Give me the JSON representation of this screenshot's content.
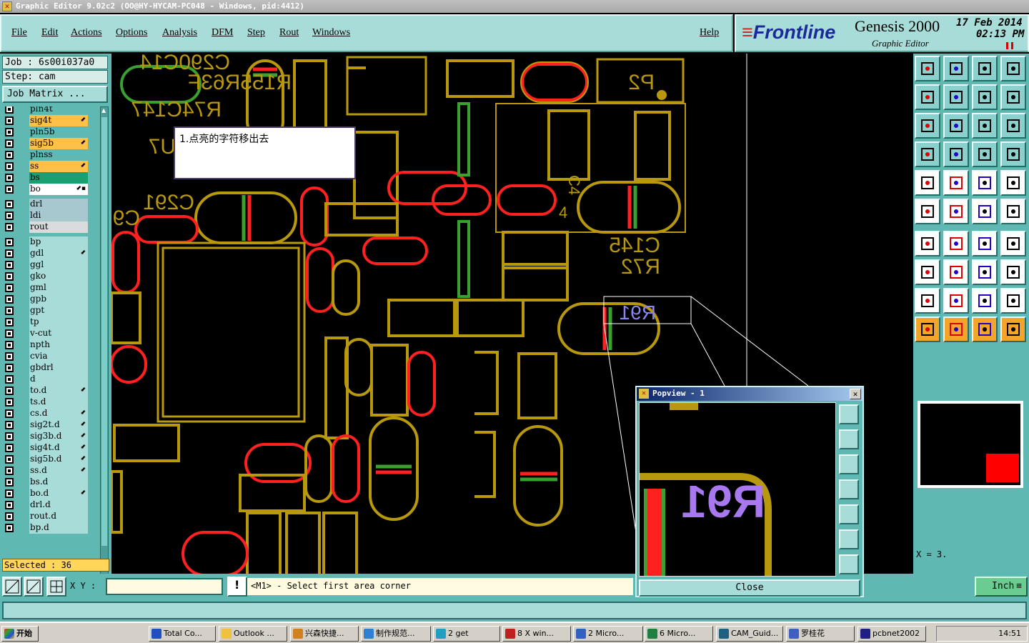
{
  "window": {
    "title": "Graphic Editor 9.02c2 (OO@HY-HYCAM-PC048 - Windows, pid:4412)"
  },
  "menu": {
    "items": [
      "File",
      "Edit",
      "Actions",
      "Options",
      "Analysis",
      "DFM",
      "Step",
      "Rout",
      "Windows"
    ],
    "help": "Help"
  },
  "brand": {
    "logo": "Frontline",
    "product": "Genesis 2000",
    "subtitle": "Graphic Editor",
    "date": "17 Feb 2014",
    "time": "02:13 PM"
  },
  "job": {
    "job_label": "Job : 6s00i037a0",
    "step_label": "Step: cam",
    "matrix_button": "Job Matrix ..."
  },
  "layers": [
    {
      "name": "pln4t",
      "color": "#5fb8b2"
    },
    {
      "name": "sig4t",
      "color": "#ffc04a",
      "flag": "⬋"
    },
    {
      "name": "pln5b",
      "color": "#5fb8b2"
    },
    {
      "name": "sig5b",
      "color": "#ffc04a",
      "flag": "⬋"
    },
    {
      "name": "plnss",
      "color": "#5fb8b2"
    },
    {
      "name": "ss",
      "color": "#ffc04a",
      "flag": "⬋"
    },
    {
      "name": "bs",
      "color": "#1aa070"
    },
    {
      "name": "bo",
      "color": "#ffffff",
      "flag": "⬋▪"
    },
    {
      "name": "drl",
      "color": "#a8c8d0"
    },
    {
      "name": "ldi",
      "color": "#a8c8d0"
    },
    {
      "name": "rout",
      "color": "#d8dcdc"
    },
    {
      "name": "bp",
      "color": "#a8dcd8"
    },
    {
      "name": "gdl",
      "color": "#a8dcd8",
      "flag": "⬋"
    },
    {
      "name": "ggl",
      "color": "#a8dcd8"
    },
    {
      "name": "gko",
      "color": "#a8dcd8"
    },
    {
      "name": "gml",
      "color": "#a8dcd8"
    },
    {
      "name": "gpb",
      "color": "#a8dcd8"
    },
    {
      "name": "gpt",
      "color": "#a8dcd8"
    },
    {
      "name": "tp",
      "color": "#a8dcd8"
    },
    {
      "name": "v-cut",
      "color": "#a8dcd8"
    },
    {
      "name": "npth",
      "color": "#a8dcd8"
    },
    {
      "name": "cvia",
      "color": "#a8dcd8"
    },
    {
      "name": "gbdrl",
      "color": "#a8dcd8"
    },
    {
      "name": "d",
      "color": "#a8dcd8"
    },
    {
      "name": "to.d",
      "color": "#a8dcd8",
      "flag": "⬋"
    },
    {
      "name": "ts.d",
      "color": "#a8dcd8"
    },
    {
      "name": "cs.d",
      "color": "#a8dcd8",
      "flag": "⬋"
    },
    {
      "name": "sig2t.d",
      "color": "#a8dcd8",
      "flag": "⬋"
    },
    {
      "name": "sig3b.d",
      "color": "#a8dcd8",
      "flag": "⬋"
    },
    {
      "name": "sig4t.d",
      "color": "#a8dcd8",
      "flag": "⬋"
    },
    {
      "name": "sig5b.d",
      "color": "#a8dcd8",
      "flag": "⬋"
    },
    {
      "name": "ss.d",
      "color": "#a8dcd8",
      "flag": "⬋"
    },
    {
      "name": "bs.d",
      "color": "#a8dcd8"
    },
    {
      "name": "bo.d",
      "color": "#a8dcd8",
      "flag": "⬋"
    },
    {
      "name": "drl.d",
      "color": "#a8dcd8"
    },
    {
      "name": "rout.d",
      "color": "#a8dcd8"
    },
    {
      "name": "bp.d",
      "color": "#a8dcd8"
    }
  ],
  "selected": "Selected : 36",
  "status": {
    "xy_label": "X Y :",
    "xy_value": "",
    "prompt": "<M1> - Select first area corner",
    "unit": "Inch",
    "x_readout": "X = 3."
  },
  "popview": {
    "title": "Popview - 1",
    "close": "Close",
    "label": "R91"
  },
  "note": "1.点亮的字符移出去",
  "canvas": {
    "labels": [
      "C290C14",
      "R155R63F",
      "R74C147",
      "P2",
      "C145",
      "R72",
      "R91",
      "C291",
      "C9",
      "U7",
      "C4",
      "4"
    ]
  },
  "taskbar": {
    "start": "开始",
    "tasks": [
      "Total Co...",
      "Outlook ...",
      "兴森快捷...",
      "制作规范...",
      "2 get",
      "8 X win...",
      "2 Micro...",
      "6 Micro...",
      "CAM_Guid...",
      "罗桂花",
      "pcbnet2002"
    ],
    "clock": "14:51"
  },
  "colors": {
    "pad_outline": "#b8980c",
    "highlight_green": "#3aa030",
    "highlight_red": "#ff2020",
    "panel": "#5fb8b2"
  }
}
